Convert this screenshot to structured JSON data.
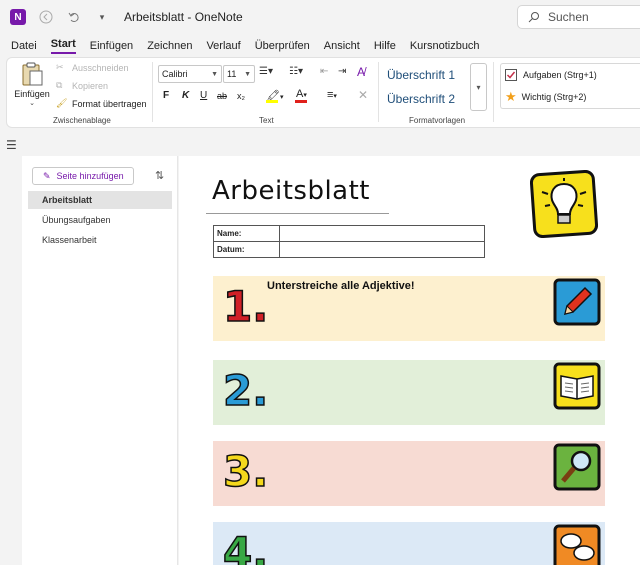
{
  "titlebar": {
    "app_icon": "N",
    "title": "Arbeitsblatt  -  OneNote",
    "search_placeholder": "Suchen"
  },
  "menu": [
    "Datei",
    "Start",
    "Einfügen",
    "Zeichnen",
    "Verlauf",
    "Überprüfen",
    "Ansicht",
    "Hilfe",
    "Kursnotizbuch"
  ],
  "menu_active": "Start",
  "ribbon": {
    "clipboard": {
      "paste": "Einfügen",
      "cut": "Ausschneiden",
      "copy": "Kopieren",
      "format_painter": "Format übertragen",
      "label": "Zwischenablage"
    },
    "text": {
      "font": "Calibri",
      "size": "11",
      "bold": "F",
      "italic": "K",
      "underline": "U",
      "strike": "ab",
      "subscript": "x₂",
      "label": "Text"
    },
    "styles": {
      "h1": "Überschrift 1",
      "h2": "Überschrift 2",
      "label": "Formatvorlagen"
    },
    "tags": {
      "todo": "Aufgaben (Strg+1)",
      "important": "Wichtig (Strg+2)"
    }
  },
  "pages": {
    "add_page": "Seite hinzufügen",
    "items": [
      "Arbeitsblatt",
      "Übungsaufgaben",
      "Klassenarbeit"
    ],
    "selected": "Arbeitsblatt"
  },
  "worksheet": {
    "title": "Arbeitsblatt",
    "fields": [
      "Name:",
      "Datum:"
    ],
    "tasks": [
      {
        "number": "1.",
        "instruction": "Unterstreiche alle Adjektive!",
        "bg": "#fdf0cf",
        "icon": "pencil-icon"
      },
      {
        "number": "2.",
        "instruction": "",
        "bg": "#e2efd9",
        "icon": "book-icon"
      },
      {
        "number": "3.",
        "instruction": "",
        "bg": "#f7dbd3",
        "icon": "magnifier-icon"
      },
      {
        "number": "4.",
        "instruction": "",
        "bg": "#dce9f6",
        "icon": "speech-bubbles-icon"
      }
    ]
  },
  "colors": {
    "accent": "#7719aa",
    "num1": "#d12027",
    "num2": "#2a9bd6",
    "num3": "#f4d81c",
    "num4": "#38a845"
  }
}
